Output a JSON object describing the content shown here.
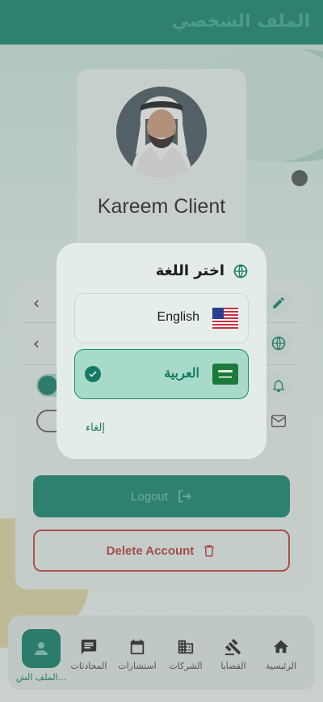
{
  "appbar": {
    "title": "الملف الشخصي"
  },
  "profile": {
    "name": "Kareem Client"
  },
  "actions": {
    "logout_label": "Logout",
    "delete_label": "Delete Account"
  },
  "settings": {
    "notifications_on": true,
    "email_on": false
  },
  "dialog": {
    "title": "اختر اللغة",
    "options": [
      {
        "label": "English",
        "flag": "us-flag",
        "selected": false
      },
      {
        "label": "العربية",
        "flag": "saudi-flag",
        "selected": true
      }
    ],
    "cancel_label": "إلغاء"
  },
  "nav": {
    "items": [
      {
        "label": "الرئيسية",
        "icon": "home-icon"
      },
      {
        "label": "القضايا",
        "icon": "gavel-icon"
      },
      {
        "label": "الشركات",
        "icon": "business-icon"
      },
      {
        "label": "استشارات",
        "icon": "calendar-icon"
      },
      {
        "label": "المحادثات",
        "icon": "chat-icon"
      },
      {
        "label": "الملف الش...",
        "icon": "person-icon",
        "active": true
      }
    ]
  },
  "colors": {
    "primary": "#147a66",
    "danger": "#b13a36"
  }
}
